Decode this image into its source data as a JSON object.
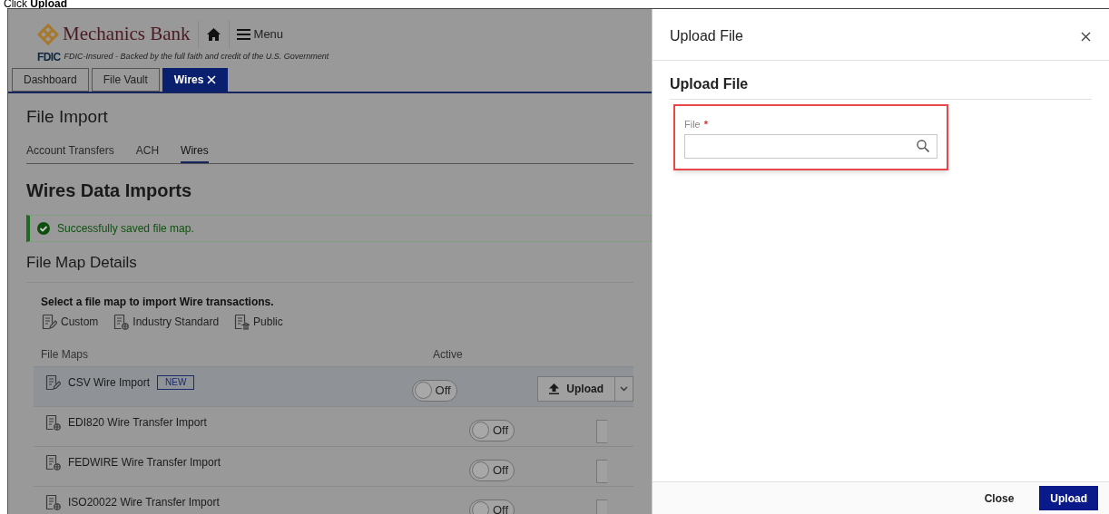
{
  "caption": "Click **Upload**",
  "brand": {
    "name": "Mechanics Bank",
    "menu": "Menu",
    "fdic_logo": "FDIC",
    "fdic_text": "FDIC-Insured - Backed by the full faith and credit of the U.S. Government"
  },
  "tabs": [
    {
      "label": "Dashboard",
      "selected": false,
      "closable": false
    },
    {
      "label": "File Vault",
      "selected": false,
      "closable": false
    },
    {
      "label": "Wires",
      "selected": true,
      "closable": true
    }
  ],
  "page_title": "File Import",
  "subtabs": [
    {
      "label": "Account Transfers",
      "selected": false
    },
    {
      "label": "ACH",
      "selected": false
    },
    {
      "label": "Wires",
      "selected": true
    }
  ],
  "section_title": "Wires Data Imports",
  "alert": "Successfully saved file map.",
  "details_title": "File Map Details",
  "instruction": "Select a file map to import Wire transactions.",
  "legend": [
    {
      "kind": "custom",
      "label": "Custom"
    },
    {
      "kind": "industry",
      "label": "Industry Standard"
    },
    {
      "kind": "public",
      "label": "Public"
    }
  ],
  "table": {
    "columns": [
      "File Maps",
      "Active"
    ],
    "rows": [
      {
        "kind": "custom",
        "name": "CSV Wire Import",
        "badge": "NEW",
        "active": false,
        "toggle_label": "Off",
        "selected": true,
        "action": "Upload"
      },
      {
        "kind": "industry",
        "name": "EDI820 Wire Transfer Import",
        "active": false,
        "toggle_label": "Off",
        "selected": false
      },
      {
        "kind": "industry",
        "name": "FEDWIRE Wire Transfer Import",
        "active": false,
        "toggle_label": "Off",
        "selected": false
      },
      {
        "kind": "industry",
        "name": "ISO20022 Wire Transfer Import",
        "active": false,
        "toggle_label": "Off",
        "selected": false
      }
    ]
  },
  "drawer": {
    "title": "Upload File",
    "section": "Upload File",
    "field": {
      "label": "File",
      "required_mark": "*"
    },
    "buttons": [
      {
        "kind": "secondary",
        "label": "Close"
      },
      {
        "kind": "primary",
        "label": "Upload"
      }
    ]
  }
}
